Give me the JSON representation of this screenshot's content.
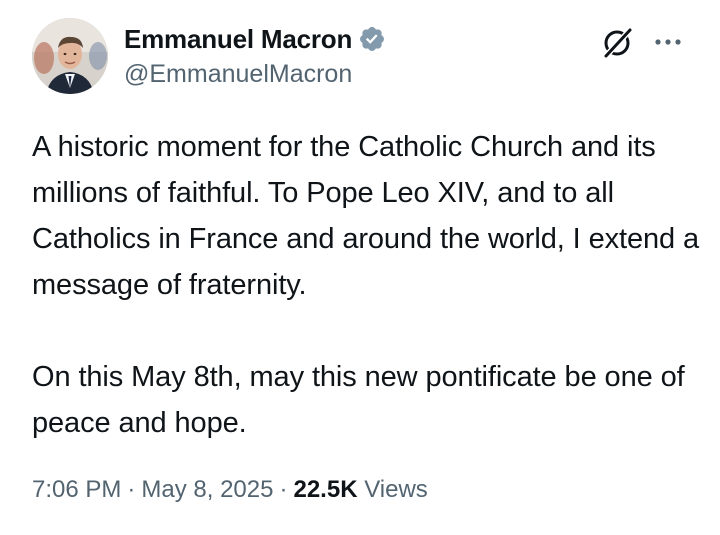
{
  "author": {
    "display_name": "Emmanuel Macron",
    "handle": "@EmmanuelMacron",
    "verified_icon": "verified-badge-icon",
    "avatar": "profile-photo"
  },
  "header_actions": {
    "grok_icon": "grok-icon",
    "more_icon": "more-options-icon"
  },
  "tweet": {
    "paragraph_1": "A historic moment for the Catholic Church and its millions of faithful. To Pope Leo XIV, and to all Catholics in France and around the world, I extend a message of fraternity.",
    "paragraph_2": "On this May 8th, may this new pontificate be one of peace and hope."
  },
  "meta": {
    "time": "7:06 PM",
    "separator": "·",
    "date": "May 8, 2025",
    "views_count": "22.5K",
    "views_label": "Views"
  },
  "colors": {
    "text_primary": "#0f1419",
    "text_secondary": "#536471",
    "verified_blue": "#829aab"
  }
}
